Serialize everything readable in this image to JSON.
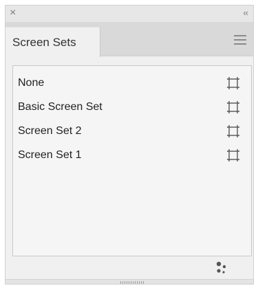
{
  "window": {
    "close_glyph": "×",
    "collapse_glyph": "‹‹"
  },
  "panel": {
    "tab_label": "Screen Sets"
  },
  "screen_sets": [
    {
      "label": "None"
    },
    {
      "label": "Basic Screen Set"
    },
    {
      "label": "Screen Set 2"
    },
    {
      "label": "Screen Set 1"
    }
  ],
  "icons": {
    "close": "close-icon",
    "collapse": "double-chevron-left-icon",
    "menu": "hamburger-menu-icon",
    "screen": "screen-frame-icon",
    "options": "dots-cluster-icon"
  },
  "colors": {
    "panel_bg": "#f0f0f0",
    "tab_strip_bg": "#d9d9d9",
    "text": "#222222",
    "icon": "#555555"
  }
}
